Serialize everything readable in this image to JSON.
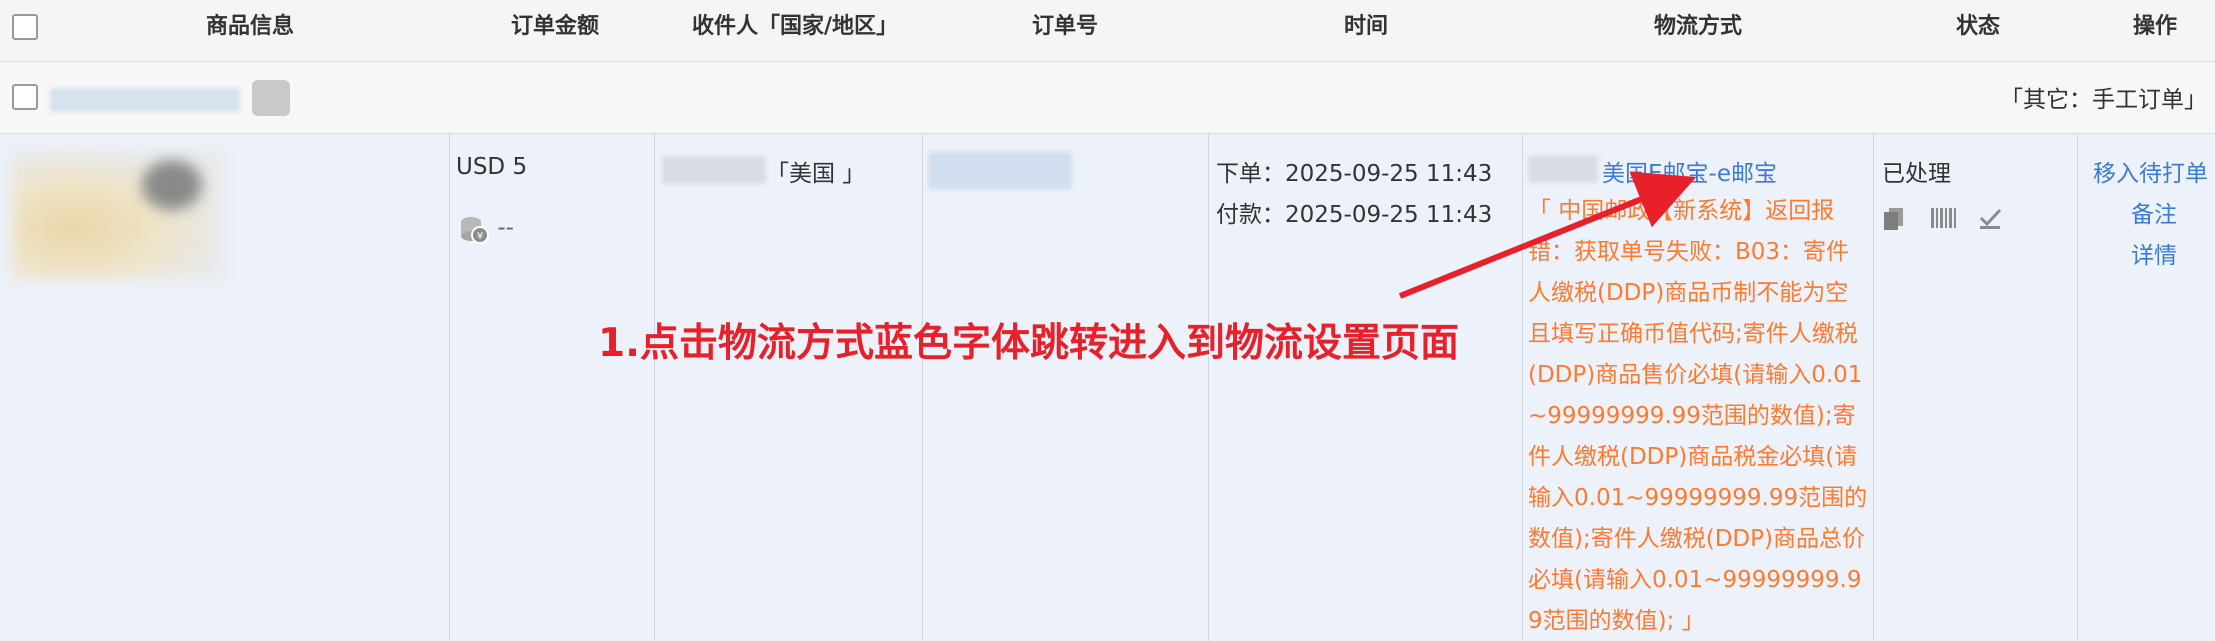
{
  "header": {
    "product_info": "商品信息",
    "order_amount": "订单金额",
    "recipient": "收件人「国家/地区」",
    "order_no": "订单号",
    "time": "时间",
    "shipping_method": "物流方式",
    "status": "状态",
    "actions": "操作"
  },
  "group": {
    "other_label": "「其它：手工订单」"
  },
  "order": {
    "amount": "USD 5",
    "fee_value": "--",
    "country": "「美国 」",
    "order_time": "下单：2025-09-25 11:43",
    "pay_time": "付款：2025-09-25 11:43",
    "shipping_link": "美国E邮宝-e邮宝",
    "error_message": "「 中国邮政【新系统】返回报错：获取单号失败：B03：寄件人缴税(DDP)商品币制不能为空且填写正确币值代码;寄件人缴税(DDP)商品售价必填(请输入0.01~99999999.99范围的数值);寄件人缴税(DDP)商品税金必填(请输入0.01~99999999.99范围的数值);寄件人缴税(DDP)商品总价必填(请输入0.01~99999999.99范围的数值); 」",
    "status": "已处理",
    "actions": {
      "move_to_print": "移入待打单",
      "note": "备注",
      "detail": "详情"
    }
  },
  "annotation": {
    "text": "1.点击物流方式蓝色字体跳转进入到物流设置页面",
    "color": "#e8202a"
  },
  "colors": {
    "link": "#3a7bd5",
    "error": "#ff7a2f",
    "row_bg": "#edf2fa"
  },
  "icons": {
    "fee": "coin-icon",
    "copy": "copy-icon",
    "barcode": "barcode-icon",
    "check": "check-icon"
  }
}
